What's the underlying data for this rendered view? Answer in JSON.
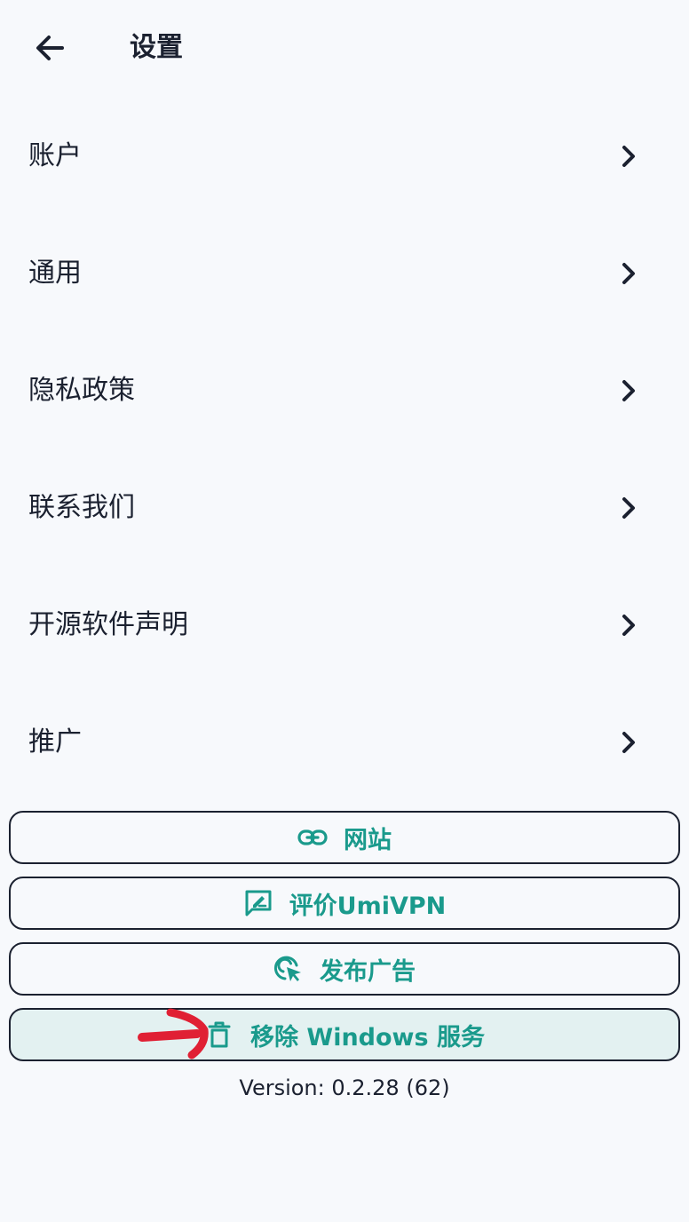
{
  "header": {
    "title": "设置",
    "back_icon": "arrow-left-icon"
  },
  "menu": {
    "items": [
      {
        "label": "账户"
      },
      {
        "label": "通用"
      },
      {
        "label": "隐私政策"
      },
      {
        "label": "联系我们"
      },
      {
        "label": "开源软件声明"
      },
      {
        "label": "推广"
      }
    ],
    "chevron_icon": "chevron-right-icon"
  },
  "actions": {
    "website": {
      "label": "网站",
      "icon": "link-icon"
    },
    "rate": {
      "label": "评价UmiVPN",
      "icon": "feedback-icon"
    },
    "ad": {
      "label": "发布广告",
      "icon": "cursor-click-icon"
    },
    "remove": {
      "label": "移除 Windows 服务",
      "icon": "trash-icon"
    }
  },
  "version": "Version: 0.2.28 (62)",
  "colors": {
    "accent": "#1a9a8c",
    "text": "#1b2130",
    "background": "#f7f9fc",
    "highlight_background": "#e3f1f1",
    "annotation": "#e02034"
  }
}
